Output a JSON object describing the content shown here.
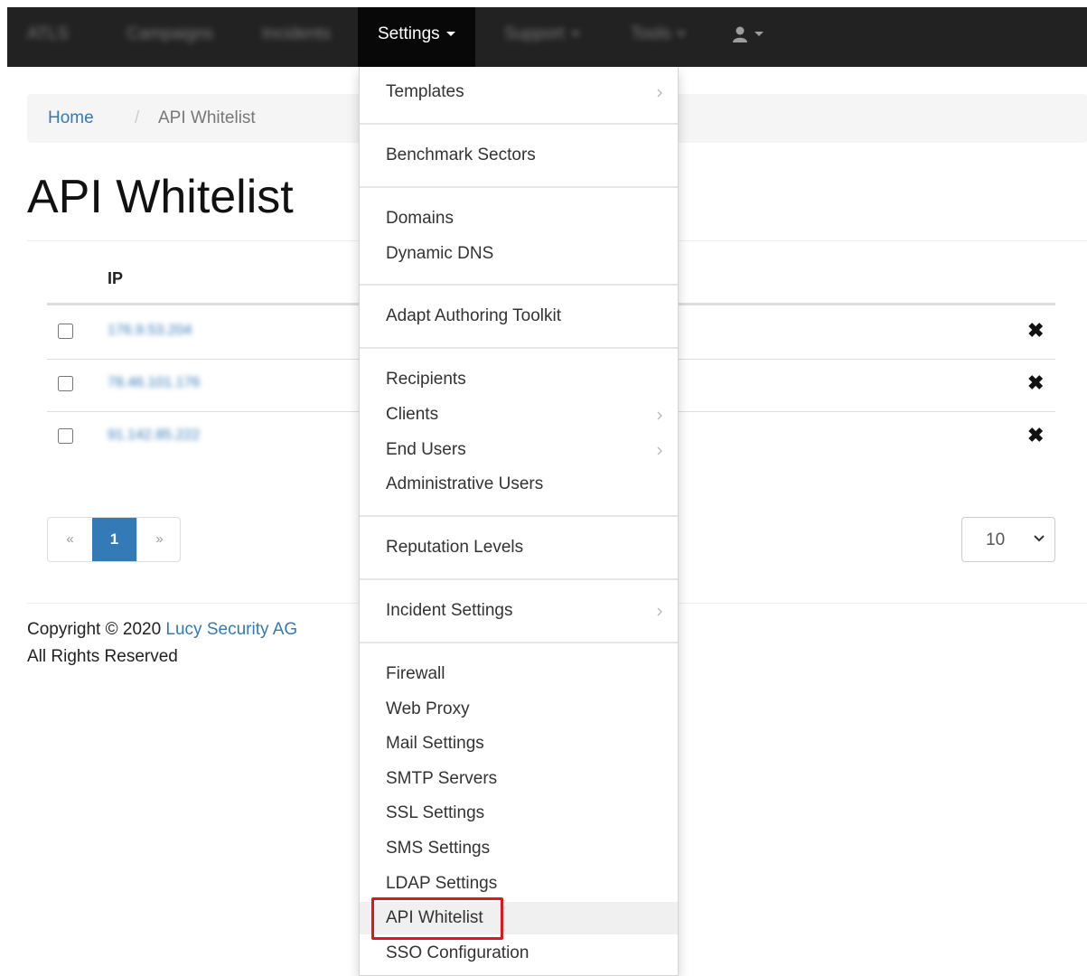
{
  "navbar": {
    "brand": "ATLS",
    "items": [
      {
        "label": "Campaigns"
      },
      {
        "label": "Incidents"
      },
      {
        "label": "Settings"
      },
      {
        "label": "Support"
      },
      {
        "label": "Tools"
      }
    ]
  },
  "breadcrumb": {
    "home": "Home",
    "separator": "/",
    "current": "API Whitelist"
  },
  "page": {
    "title": "API Whitelist"
  },
  "table": {
    "column_ip": "IP",
    "rows": [
      {
        "ip": "176.9.53.204"
      },
      {
        "ip": "78.46.101.176"
      },
      {
        "ip": "91.142.85.222"
      }
    ]
  },
  "pagination": {
    "prev": "«",
    "current": "1",
    "next": "»"
  },
  "page_size": {
    "value": "10"
  },
  "footer": {
    "copyright": "Copyright © 2020 ",
    "company": "Lucy Security AG",
    "rights": "All Rights Reserved"
  },
  "settings_menu": {
    "items": [
      "Templates",
      "Benchmark Sectors",
      "Domains",
      "Dynamic DNS",
      "Adapt Authoring Toolkit",
      "Recipients",
      "Clients",
      "End Users",
      "Administrative Users",
      "Reputation Levels",
      "Incident Settings",
      "Firewall",
      "Web Proxy",
      "Mail Settings",
      "SMTP Servers",
      "SSL Settings",
      "SMS Settings",
      "LDAP Settings",
      "API Whitelist",
      "SSO Configuration"
    ]
  },
  "colors": {
    "navbar_bg": "#222222",
    "link": "#337ab7",
    "highlight_box": "#e3141b"
  }
}
